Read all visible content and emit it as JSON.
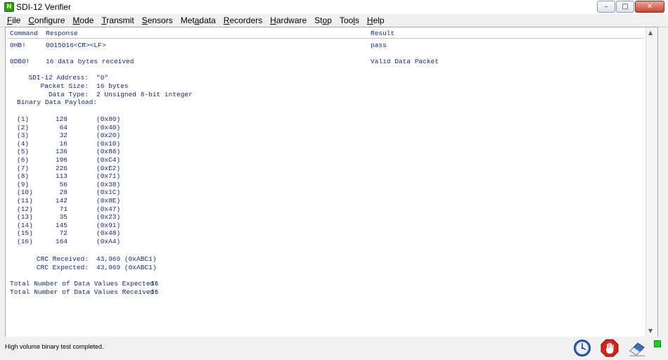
{
  "window": {
    "title": "SDI-12 Verifier",
    "app_icon_glyph": "N"
  },
  "menu": [
    {
      "u": "F",
      "rest": "ile"
    },
    {
      "u": "C",
      "rest": "onfigure"
    },
    {
      "u": "M",
      "rest": "ode"
    },
    {
      "u": "T",
      "rest": "ransmit"
    },
    {
      "u": "S",
      "rest": "ensors"
    },
    {
      "pre": "Met",
      "u": "a",
      "rest": "data"
    },
    {
      "u": "R",
      "rest": "ecorders"
    },
    {
      "u": "H",
      "rest": "ardware"
    },
    {
      "pre": "St",
      "u": "o",
      "rest": "p"
    },
    {
      "pre": "Too",
      "u": "l",
      "rest": "s"
    },
    {
      "u": "H",
      "rest": "elp"
    }
  ],
  "table_header": {
    "command": "Command",
    "response": "Response",
    "result": "Result"
  },
  "rows": [
    {
      "command": "0HB!",
      "response": "0015016<CR><LF>",
      "result": "pass"
    },
    {
      "command": "0DB0!",
      "response": "16 data bytes received",
      "result": "Valid Data Packet"
    }
  ],
  "packet": {
    "address_label": "SDI-12 Address:",
    "address_value": "\"0\"",
    "size_label": "Packet Size:",
    "size_value": "16 bytes",
    "type_label": "Data Type:",
    "type_value": "2 Unsigned 8-bit integer",
    "payload_label": "Binary Data Payload:"
  },
  "payload": [
    {
      "idx": "(1)",
      "dec": "128",
      "hex": "(0x80)"
    },
    {
      "idx": "(2)",
      "dec": "64",
      "hex": "(0x40)"
    },
    {
      "idx": "(3)",
      "dec": "32",
      "hex": "(0x20)"
    },
    {
      "idx": "(4)",
      "dec": "16",
      "hex": "(0x10)"
    },
    {
      "idx": "(5)",
      "dec": "136",
      "hex": "(0x88)"
    },
    {
      "idx": "(6)",
      "dec": "196",
      "hex": "(0xC4)"
    },
    {
      "idx": "(7)",
      "dec": "226",
      "hex": "(0xE2)"
    },
    {
      "idx": "(8)",
      "dec": "113",
      "hex": "(0x71)"
    },
    {
      "idx": "(9)",
      "dec": "56",
      "hex": "(0x38)"
    },
    {
      "idx": "(10)",
      "dec": "28",
      "hex": "(0x1C)"
    },
    {
      "idx": "(11)",
      "dec": "142",
      "hex": "(0x8E)"
    },
    {
      "idx": "(12)",
      "dec": "71",
      "hex": "(0x47)"
    },
    {
      "idx": "(13)",
      "dec": "35",
      "hex": "(0x23)"
    },
    {
      "idx": "(14)",
      "dec": "145",
      "hex": "(0x91)"
    },
    {
      "idx": "(15)",
      "dec": "72",
      "hex": "(0x48)"
    },
    {
      "idx": "(16)",
      "dec": "164",
      "hex": "(0xA4)"
    }
  ],
  "crc": {
    "received_label": "CRC Received:",
    "received_value": "43,969 (0xABC1)",
    "expected_label": "CRC Expected:",
    "expected_value": "43,969 (0xABC1)"
  },
  "totals": {
    "expected_label": "Total Number of Data Values Expected:",
    "expected_value": "16",
    "received_label": "Total Number of Data Values Received:",
    "received_value": "16"
  },
  "status": {
    "message": "High volume binary test completed.",
    "icons": [
      "clock-icon",
      "stop-hand-icon",
      "eraser-icon"
    ],
    "led_color": "#19d119"
  },
  "colors": {
    "text": "#1a2a7a",
    "background": "#ffffff"
  }
}
